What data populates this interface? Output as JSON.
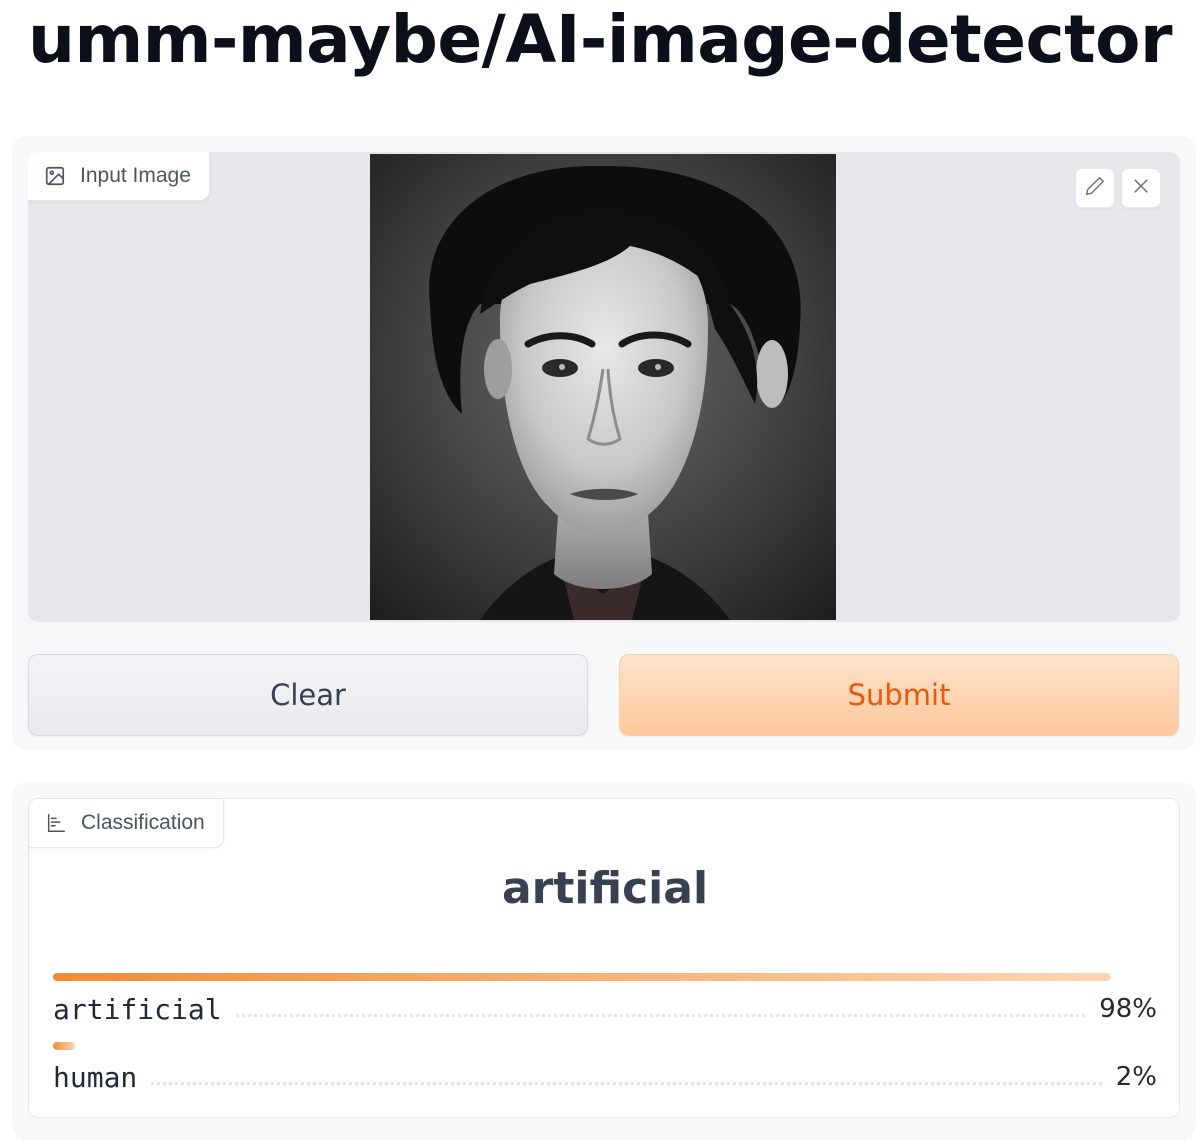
{
  "page": {
    "title": "umm-maybe/AI-image-detector"
  },
  "input": {
    "label": "Input Image",
    "label_icon": "image-icon",
    "image_alt": "Black and white portrait of a young man with dark wavy hair",
    "tools": {
      "edit_icon": "pencil-icon",
      "close_icon": "close-icon"
    }
  },
  "buttons": {
    "clear_label": "Clear",
    "submit_label": "Submit"
  },
  "output": {
    "label": "Classification",
    "label_icon": "bar-chart-icon",
    "predicted_label": "artificial",
    "confidences": [
      {
        "label": "artificial",
        "value_text": "98%",
        "value": 0.98
      },
      {
        "label": "human",
        "value_text": "2%",
        "value": 0.02
      }
    ]
  },
  "colors": {
    "accent": "#f97316",
    "submit_text": "#ea580c",
    "submit_bg": "#fdd5b4"
  }
}
